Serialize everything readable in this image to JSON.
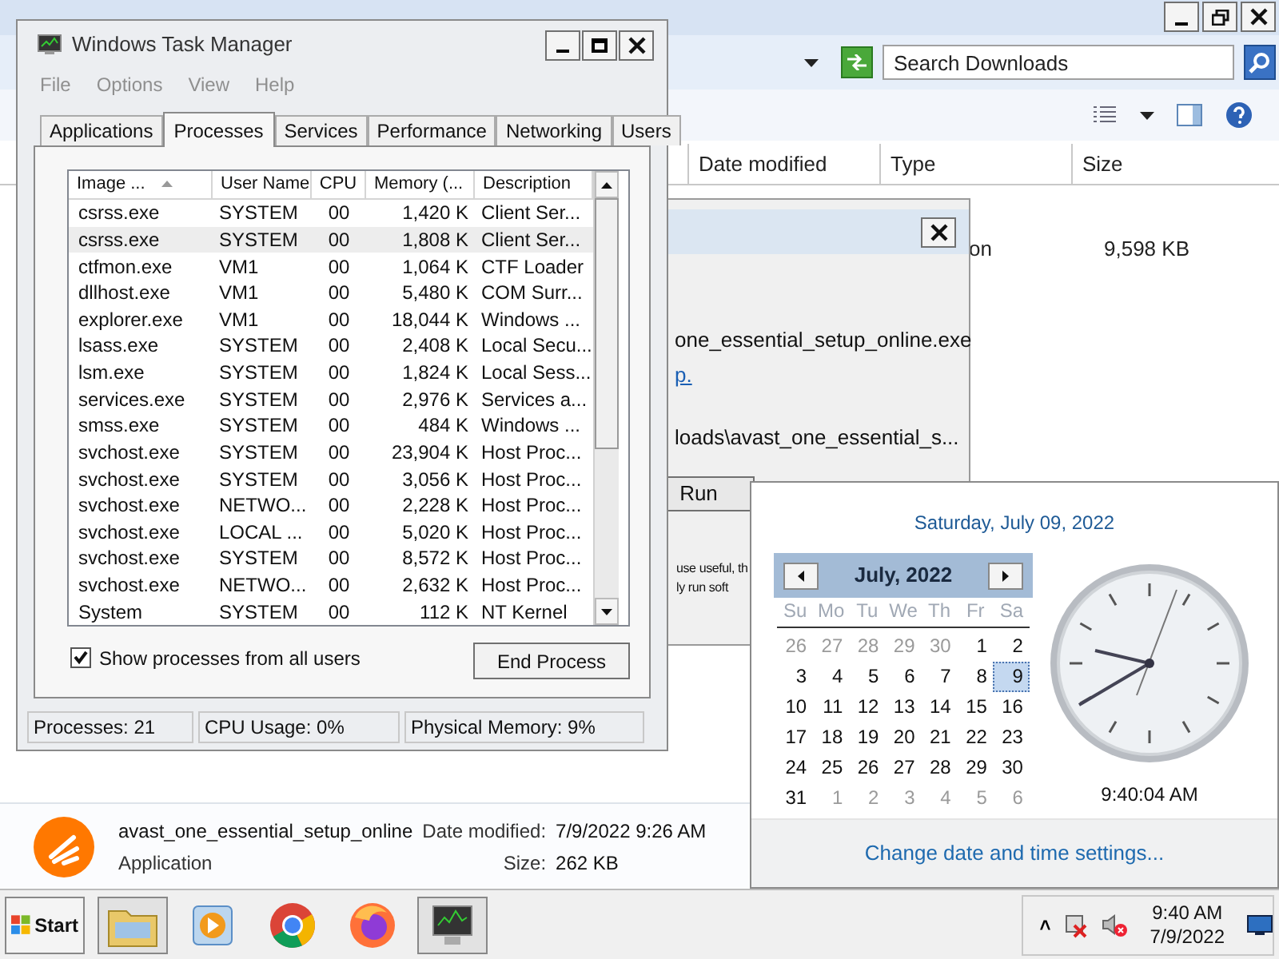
{
  "explorer": {
    "search": {
      "placeholder": "Search Downloads"
    },
    "columns": [
      "Date modified",
      "Type",
      "Size"
    ],
    "row": {
      "type": "on",
      "size": "9,598 KB"
    },
    "details": {
      "name": "avast_one_essential_setup_online",
      "type": "Application",
      "date_label": "Date modified:",
      "date": "7/9/2022 9:26 AM",
      "size_label": "Size:",
      "size": "262 KB"
    }
  },
  "security_dialog": {
    "lines": [
      "one_essential_setup_online.exe",
      "loads\\avast_one_essential_s..."
    ],
    "link": "p.",
    "buttons": [
      "Run"
    ],
    "notes": [
      "use useful, th",
      "ly run soft"
    ]
  },
  "task_manager": {
    "title": "Windows Task Manager",
    "menu": [
      "File",
      "Options",
      "View",
      "Help"
    ],
    "tabs": [
      {
        "label": "Applications",
        "selected": false
      },
      {
        "label": "Processes",
        "selected": true
      },
      {
        "label": "Services",
        "selected": false
      },
      {
        "label": "Performance",
        "selected": false
      },
      {
        "label": "Networking",
        "selected": false
      },
      {
        "label": "Users",
        "selected": false
      }
    ],
    "columns": [
      "Image ...",
      "User Name",
      "CPU",
      "Memory (...",
      "Description"
    ],
    "rows": [
      {
        "image": "csrss.exe",
        "user": "SYSTEM",
        "cpu": "00",
        "memory": "1,420 K",
        "description": "Client Ser...",
        "selected": false
      },
      {
        "image": "csrss.exe",
        "user": "SYSTEM",
        "cpu": "00",
        "memory": "1,808 K",
        "description": "Client Ser...",
        "selected": true
      },
      {
        "image": "ctfmon.exe",
        "user": "VM1",
        "cpu": "00",
        "memory": "1,064 K",
        "description": "CTF Loader",
        "selected": false
      },
      {
        "image": "dllhost.exe",
        "user": "VM1",
        "cpu": "00",
        "memory": "5,480 K",
        "description": "COM Surr...",
        "selected": false
      },
      {
        "image": "explorer.exe",
        "user": "VM1",
        "cpu": "00",
        "memory": "18,044 K",
        "description": "Windows ...",
        "selected": false
      },
      {
        "image": "lsass.exe",
        "user": "SYSTEM",
        "cpu": "00",
        "memory": "2,408 K",
        "description": "Local Secu...",
        "selected": false
      },
      {
        "image": "lsm.exe",
        "user": "SYSTEM",
        "cpu": "00",
        "memory": "1,824 K",
        "description": "Local Sess...",
        "selected": false
      },
      {
        "image": "services.exe",
        "user": "SYSTEM",
        "cpu": "00",
        "memory": "2,976 K",
        "description": "Services a...",
        "selected": false
      },
      {
        "image": "smss.exe",
        "user": "SYSTEM",
        "cpu": "00",
        "memory": "484 K",
        "description": "Windows ...",
        "selected": false
      },
      {
        "image": "svchost.exe",
        "user": "SYSTEM",
        "cpu": "00",
        "memory": "23,904 K",
        "description": "Host Proc...",
        "selected": false
      },
      {
        "image": "svchost.exe",
        "user": "SYSTEM",
        "cpu": "00",
        "memory": "3,056 K",
        "description": "Host Proc...",
        "selected": false
      },
      {
        "image": "svchost.exe",
        "user": "NETWO...",
        "cpu": "00",
        "memory": "2,228 K",
        "description": "Host Proc...",
        "selected": false
      },
      {
        "image": "svchost.exe",
        "user": "LOCAL ...",
        "cpu": "00",
        "memory": "5,020 K",
        "description": "Host Proc...",
        "selected": false
      },
      {
        "image": "svchost.exe",
        "user": "SYSTEM",
        "cpu": "00",
        "memory": "8,572 K",
        "description": "Host Proc...",
        "selected": false
      },
      {
        "image": "svchost.exe",
        "user": "NETWO...",
        "cpu": "00",
        "memory": "2,632 K",
        "description": "Host Proc...",
        "selected": false
      },
      {
        "image": "System",
        "user": "SYSTEM",
        "cpu": "00",
        "memory": "112 K",
        "description": "NT Kernel",
        "selected": false
      }
    ],
    "show_all": {
      "label": "Show processes from all users",
      "checked": true
    },
    "end_button": "End Process",
    "status": [
      "Processes: 21",
      "CPU Usage: 0%",
      "Physical Memory: 9%"
    ]
  },
  "calendar": {
    "heading": "Saturday, July 09, 2022",
    "month": "July, 2022",
    "weekdays": [
      "Su",
      "Mo",
      "Tu",
      "We",
      "Th",
      "Fr",
      "Sa"
    ],
    "days": [
      {
        "label": "26",
        "current_month": false,
        "selected": false
      },
      {
        "label": "27",
        "current_month": false,
        "selected": false
      },
      {
        "label": "28",
        "current_month": false,
        "selected": false
      },
      {
        "label": "29",
        "current_month": false,
        "selected": false
      },
      {
        "label": "30",
        "current_month": false,
        "selected": false
      },
      {
        "label": "1",
        "current_month": true,
        "selected": false
      },
      {
        "label": "2",
        "current_month": true,
        "selected": false
      },
      {
        "label": "3",
        "current_month": true,
        "selected": false
      },
      {
        "label": "4",
        "current_month": true,
        "selected": false
      },
      {
        "label": "5",
        "current_month": true,
        "selected": false
      },
      {
        "label": "6",
        "current_month": true,
        "selected": false
      },
      {
        "label": "7",
        "current_month": true,
        "selected": false
      },
      {
        "label": "8",
        "current_month": true,
        "selected": false
      },
      {
        "label": "9",
        "current_month": true,
        "selected": true
      },
      {
        "label": "10",
        "current_month": true,
        "selected": false
      },
      {
        "label": "11",
        "current_month": true,
        "selected": false
      },
      {
        "label": "12",
        "current_month": true,
        "selected": false
      },
      {
        "label": "13",
        "current_month": true,
        "selected": false
      },
      {
        "label": "14",
        "current_month": true,
        "selected": false
      },
      {
        "label": "15",
        "current_month": true,
        "selected": false
      },
      {
        "label": "16",
        "current_month": true,
        "selected": false
      },
      {
        "label": "17",
        "current_month": true,
        "selected": false
      },
      {
        "label": "18",
        "current_month": true,
        "selected": false
      },
      {
        "label": "19",
        "current_month": true,
        "selected": false
      },
      {
        "label": "20",
        "current_month": true,
        "selected": false
      },
      {
        "label": "21",
        "current_month": true,
        "selected": false
      },
      {
        "label": "22",
        "current_month": true,
        "selected": false
      },
      {
        "label": "23",
        "current_month": true,
        "selected": false
      },
      {
        "label": "24",
        "current_month": true,
        "selected": false
      },
      {
        "label": "25",
        "current_month": true,
        "selected": false
      },
      {
        "label": "26",
        "current_month": true,
        "selected": false
      },
      {
        "label": "27",
        "current_month": true,
        "selected": false
      },
      {
        "label": "28",
        "current_month": true,
        "selected": false
      },
      {
        "label": "29",
        "current_month": true,
        "selected": false
      },
      {
        "label": "30",
        "current_month": true,
        "selected": false
      },
      {
        "label": "31",
        "current_month": true,
        "selected": false
      },
      {
        "label": "1",
        "current_month": false,
        "selected": false
      },
      {
        "label": "2",
        "current_month": false,
        "selected": false
      },
      {
        "label": "3",
        "current_month": false,
        "selected": false
      },
      {
        "label": "4",
        "current_month": false,
        "selected": false
      },
      {
        "label": "5",
        "current_month": false,
        "selected": false
      },
      {
        "label": "6",
        "current_month": false,
        "selected": false
      }
    ],
    "time": "9:40:04 AM",
    "link": "Change date and time settings..."
  },
  "taskbar": {
    "start": "Start",
    "apps": [
      {
        "kind": "folder"
      },
      {
        "kind": "media"
      },
      {
        "kind": "chrome"
      },
      {
        "kind": "firefox"
      },
      {
        "kind": "monitor"
      }
    ],
    "tray_arrow": "˄",
    "time": "9:40 AM",
    "date": "7/9/2022"
  }
}
